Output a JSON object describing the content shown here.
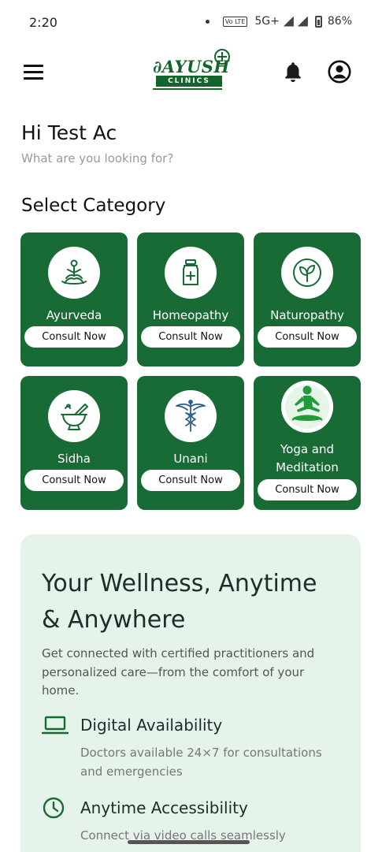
{
  "status_bar": {
    "time": "2:20",
    "network": "5G+",
    "vo_badge": "Vo LTE",
    "battery": "86%"
  },
  "app_bar": {
    "logo_main": "∂AYUSH",
    "logo_sub": "CLINICS"
  },
  "greeting": "Hi Test Ac",
  "subtitle": "What are you looking for?",
  "section_title": "Select Category",
  "categories": [
    {
      "name": "Ayurveda",
      "button": "Consult Now",
      "icon": "meditation-lotus-icon"
    },
    {
      "name": "Homeopathy",
      "button": "Consult Now",
      "icon": "medicine-bottle-icon"
    },
    {
      "name": "Naturopathy",
      "button": "Consult Now",
      "icon": "leaf-icon"
    },
    {
      "name": "Sidha",
      "button": "Consult Now",
      "icon": "mortar-pestle-icon"
    },
    {
      "name": "Unani",
      "button": "Consult Now",
      "icon": "caduceus-icon"
    },
    {
      "name": "Yoga and Meditation",
      "button": "Consult Now",
      "icon": "yoga-pose-icon"
    }
  ],
  "wellness": {
    "title": "Your Wellness, Anytime & Anywhere",
    "description": "Get connected with certified practitioners and personalized care—from the comfort of your home.",
    "features": [
      {
        "title": "Digital Availability",
        "description": "Doctors available 24×7 for consultations and emergencies",
        "icon": "laptop-icon"
      },
      {
        "title": "Anytime Accessibility",
        "description": "Connect via video calls seamlessly",
        "icon": "clock-icon"
      }
    ]
  },
  "colors": {
    "primary_green": "#186b35",
    "card_bg": "#e5f3ea",
    "title_dark": "#17302a"
  }
}
